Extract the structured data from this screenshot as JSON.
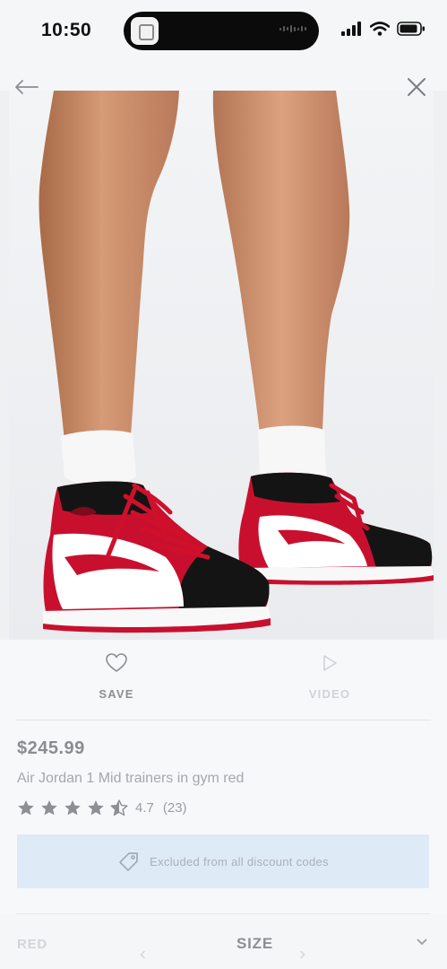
{
  "status_bar": {
    "time": "10:50",
    "icons": [
      "cellular-signal-icon",
      "wifi-icon",
      "battery-icon"
    ]
  },
  "nav": {
    "back_icon": "arrow-left-icon",
    "close_icon": "close-icon"
  },
  "product": {
    "image": "product-photo-red-black-white-mid-sneakers",
    "price": "$245.99",
    "title": "Air Jordan 1 Mid trainers in gym red",
    "rating": {
      "value": "4.7",
      "count": "(23)",
      "stars": 4.5
    },
    "discount_notice": "Excluded from all discount codes"
  },
  "actions": {
    "save_label": "SAVE",
    "video_label": "VIDEO"
  },
  "selectors": {
    "colour_value": "RED",
    "size_label": "SIZE"
  },
  "colors": {
    "accent_blue": "#dfeaf7",
    "shoe_red": "#c8102e",
    "text_muted": "#8a8d90"
  }
}
